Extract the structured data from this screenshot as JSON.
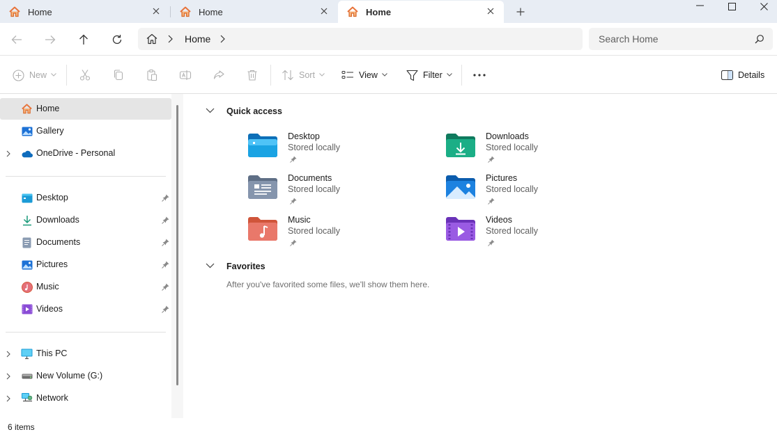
{
  "tabs": [
    {
      "label": "Home",
      "state": "inactive"
    },
    {
      "label": "Home",
      "state": "inactive"
    },
    {
      "label": "Home",
      "state": "active"
    }
  ],
  "address": {
    "crumb": "Home",
    "search_placeholder": "Search Home"
  },
  "commands": {
    "new": "New",
    "sort": "Sort",
    "view": "View",
    "filter": "Filter",
    "details": "Details"
  },
  "sidebar": {
    "top": [
      {
        "label": "Home",
        "icon": "home-icon",
        "selected": true
      },
      {
        "label": "Gallery",
        "icon": "gallery-icon"
      },
      {
        "label": "OneDrive - Personal",
        "icon": "onedrive-icon",
        "expandable": true
      }
    ],
    "pinned": [
      {
        "label": "Desktop",
        "icon": "desktop-folder-icon"
      },
      {
        "label": "Downloads",
        "icon": "downloads-icon"
      },
      {
        "label": "Documents",
        "icon": "documents-icon"
      },
      {
        "label": "Pictures",
        "icon": "pictures-icon"
      },
      {
        "label": "Music",
        "icon": "music-icon"
      },
      {
        "label": "Videos",
        "icon": "videos-icon"
      }
    ],
    "drives": [
      {
        "label": "This PC",
        "icon": "this-pc-icon"
      },
      {
        "label": "New Volume (G:)",
        "icon": "drive-icon"
      },
      {
        "label": "Network",
        "icon": "network-icon"
      }
    ]
  },
  "quick_access": {
    "title": "Quick access",
    "items": [
      {
        "name": "Desktop",
        "status": "Stored locally"
      },
      {
        "name": "Downloads",
        "status": "Stored locally"
      },
      {
        "name": "Documents",
        "status": "Stored locally"
      },
      {
        "name": "Pictures",
        "status": "Stored locally"
      },
      {
        "name": "Music",
        "status": "Stored locally"
      },
      {
        "name": "Videos",
        "status": "Stored locally"
      }
    ]
  },
  "favorites": {
    "title": "Favorites",
    "empty_text": "After you've favorited some files, we'll show them here."
  },
  "status": {
    "item_count": "6 items"
  },
  "colors": {
    "tabbar_bg": "#e8edf4",
    "selected_bg": "#e5e5e5",
    "home_orange": "#e8733a",
    "accent_blue": "#0f6cbd"
  }
}
